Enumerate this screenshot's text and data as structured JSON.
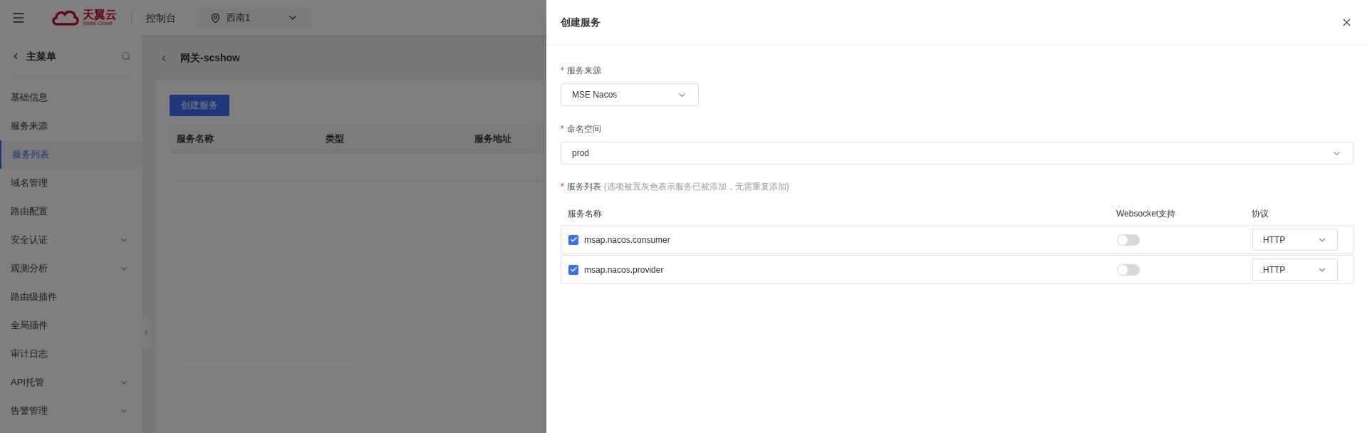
{
  "header": {
    "logo": {
      "name": "天翼云",
      "subtitle": "State Cloud"
    },
    "console": "控制台",
    "region": "西南1"
  },
  "sidebar": {
    "title": "主菜单",
    "items": [
      {
        "label": "基础信息",
        "selected": false,
        "expandable": false
      },
      {
        "label": "服务来源",
        "selected": false,
        "expandable": false
      },
      {
        "label": "服务列表",
        "selected": true,
        "expandable": false
      },
      {
        "label": "域名管理",
        "selected": false,
        "expandable": false
      },
      {
        "label": "路由配置",
        "selected": false,
        "expandable": false
      },
      {
        "label": "安全认证",
        "selected": false,
        "expandable": true
      },
      {
        "label": "观测分析",
        "selected": false,
        "expandable": true
      },
      {
        "label": "路由级插件",
        "selected": false,
        "expandable": false
      },
      {
        "label": "全局插件",
        "selected": false,
        "expandable": false
      },
      {
        "label": "审计日志",
        "selected": false,
        "expandable": false
      },
      {
        "label": "API托管",
        "selected": false,
        "expandable": true
      },
      {
        "label": "告警管理",
        "selected": false,
        "expandable": true
      }
    ]
  },
  "page": {
    "title": "网关-scshow",
    "create_button": "创建服务",
    "table": {
      "columns": [
        "服务名称",
        "类型",
        "服务地址"
      ]
    }
  },
  "drawer": {
    "title": "创建服务",
    "source": {
      "label": "服务来源",
      "required_mark": "*",
      "value": "MSE Nacos"
    },
    "namespace": {
      "label": "命名空间",
      "required_mark": "*",
      "value": "prod"
    },
    "service_list": {
      "label": "服务列表",
      "hint": "(选项被置灰色表示服务已被添加，无需重复添加)",
      "required_mark": "*",
      "columns": [
        "服务名称",
        "Websocket支持",
        "协议"
      ],
      "rows": [
        {
          "name": "msap.nacos.consumer",
          "checked": true,
          "websocket": false,
          "protocol": "HTTP"
        },
        {
          "name": "msap.nacos.provider",
          "checked": true,
          "websocket": false,
          "protocol": "HTTP"
        }
      ]
    }
  }
}
